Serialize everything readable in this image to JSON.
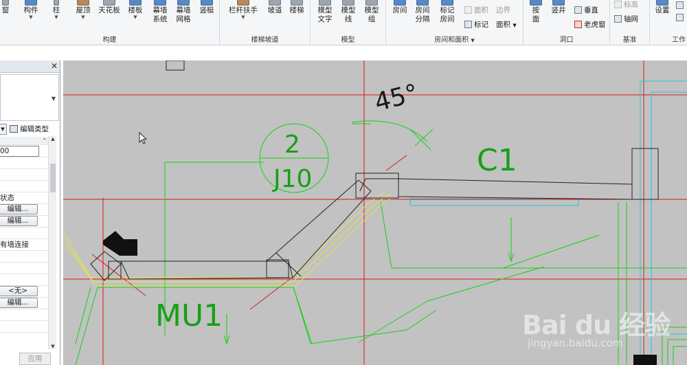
{
  "ribbon": {
    "groups": {
      "build": {
        "label": "构建",
        "buttons": {
          "window": "窗",
          "component": "构件",
          "column": "柱",
          "roof": "屋顶",
          "ceiling": "天花板",
          "floor": "楼板",
          "curtain_system": "幕墙\n系统",
          "curtain_grid": "幕墙\n网格",
          "mullion": "竖梃"
        }
      },
      "stairs": {
        "label": "楼梯坡道",
        "buttons": {
          "railing": "栏杆扶手",
          "ramp": "坡道",
          "stair": "楼梯"
        }
      },
      "model": {
        "label": "模型",
        "buttons": {
          "model_text": "模型\n文字",
          "model_line": "模型\n线",
          "model_group": "模型\n组"
        }
      },
      "room_area": {
        "label": "房间和面积",
        "buttons": {
          "room": "房间",
          "room_separator": "房间\n分隔",
          "tag_room": "标记\n房间",
          "area": "面积",
          "area_boundary": "边界",
          "tag_area": "标记",
          "area_caret": "面积"
        }
      },
      "opening": {
        "label": "洞口",
        "buttons": {
          "by_face": "按\n面",
          "shaft": "竖井",
          "vertical": "垂直",
          "dormer": "老虎窗"
        }
      },
      "datum": {
        "label": "基准",
        "buttons": {
          "level": "标高",
          "grid": "轴网"
        }
      },
      "work_plane": {
        "label": "工作",
        "buttons": {
          "set": "设置"
        }
      }
    }
  },
  "properties": {
    "close_glyph": "✕",
    "edit_type_label": "编辑类型",
    "rows": {
      "value_field": "00",
      "structure_status": "状态",
      "edit1": "编辑...",
      "edit2": "编辑...",
      "char_a": "",
      "join_all": "有墙连接",
      "char_b": "",
      "none_option": "<无>",
      "edit3": "编辑..."
    },
    "apply_label": "应用"
  },
  "canvas": {
    "angle_label": "45°",
    "callout_number": "2",
    "callout_sheet": "J10",
    "window_tag": "C1",
    "wall_tag": "MU1",
    "colors": {
      "background": "#c2c2c2",
      "grid_red": "#e0141a",
      "green": "#16d016",
      "cyan": "#22c6d6",
      "yellow": "#e6e24a",
      "wall": "#222222"
    }
  },
  "watermark": {
    "brand": "Bai du 经验",
    "url": "jingyan.baidu.com"
  }
}
